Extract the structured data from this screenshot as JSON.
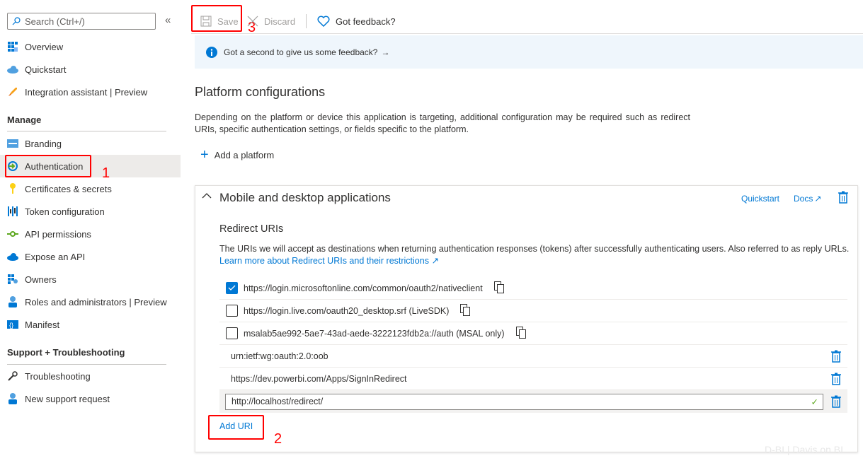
{
  "sidebar": {
    "search_placeholder": "Search (Ctrl+/)",
    "collapse": "«",
    "items_top": [
      {
        "label": "Overview",
        "icon": "overview-grid-icon"
      },
      {
        "label": "Quickstart",
        "icon": "cloud-icon"
      },
      {
        "label": "Integration assistant | Preview",
        "icon": "rocket-icon"
      }
    ],
    "manage_header": "Manage",
    "manage_items": [
      {
        "label": "Branding",
        "icon": "branding-icon"
      },
      {
        "label": "Authentication",
        "icon": "authentication-icon",
        "selected": true
      },
      {
        "label": "Certificates & secrets",
        "icon": "key-icon"
      },
      {
        "label": "Token configuration",
        "icon": "token-icon"
      },
      {
        "label": "API permissions",
        "icon": "api-permissions-icon"
      },
      {
        "label": "Expose an API",
        "icon": "cloud-icon"
      },
      {
        "label": "Owners",
        "icon": "owners-icon"
      },
      {
        "label": "Roles and administrators | Preview",
        "icon": "roles-icon"
      },
      {
        "label": "Manifest",
        "icon": "manifest-icon"
      }
    ],
    "support_header": "Support + Troubleshooting",
    "support_items": [
      {
        "label": "Troubleshooting",
        "icon": "wrench-icon"
      },
      {
        "label": "New support request",
        "icon": "support-person-icon"
      }
    ]
  },
  "annotations": {
    "one": "1",
    "two": "2",
    "three": "3",
    "color": "#ff0000"
  },
  "toolbar": {
    "save": "Save",
    "discard": "Discard",
    "feedback": "Got feedback?"
  },
  "banner": {
    "text": "Got a second to give us some feedback?",
    "arrow": "→"
  },
  "main": {
    "title": "Platform configurations",
    "description": "Depending on the platform or device this application is targeting, additional configuration may be required such as redirect URIs, specific authentication settings, or fields specific to the platform.",
    "add_platform": "Add a platform"
  },
  "card": {
    "title": "Mobile and desktop applications",
    "quickstart": "Quickstart",
    "docs": "Docs",
    "redirect_title": "Redirect URIs",
    "redirect_desc": "The URIs we will accept as destinations when returning authentication responses (tokens) after successfully authenticating users. Also referred to as reply URLs.",
    "learn_more": "Learn more about Redirect URIs and their restrictions",
    "suggested": [
      {
        "uri": "https://login.microsoftonline.com/common/oauth2/nativeclient",
        "checked": true
      },
      {
        "uri": "https://login.live.com/oauth20_desktop.srf (LiveSDK)",
        "checked": false
      },
      {
        "uri": "msalab5ae992-5ae7-43ad-aede-3222123fdb2a://auth (MSAL only)",
        "checked": false
      }
    ],
    "custom": [
      "urn:ietf:wg:oauth:2.0:oob",
      "https://dev.powerbi.com/Apps/SignInRedirect"
    ],
    "input_value": "http://localhost/redirect/",
    "add_uri": "Add URI"
  },
  "watermark": "D-BI | Davis on BI",
  "colors": {
    "accent": "#0078d4",
    "banner_bg": "#eff6fc",
    "selected_bg": "#edebe9"
  }
}
